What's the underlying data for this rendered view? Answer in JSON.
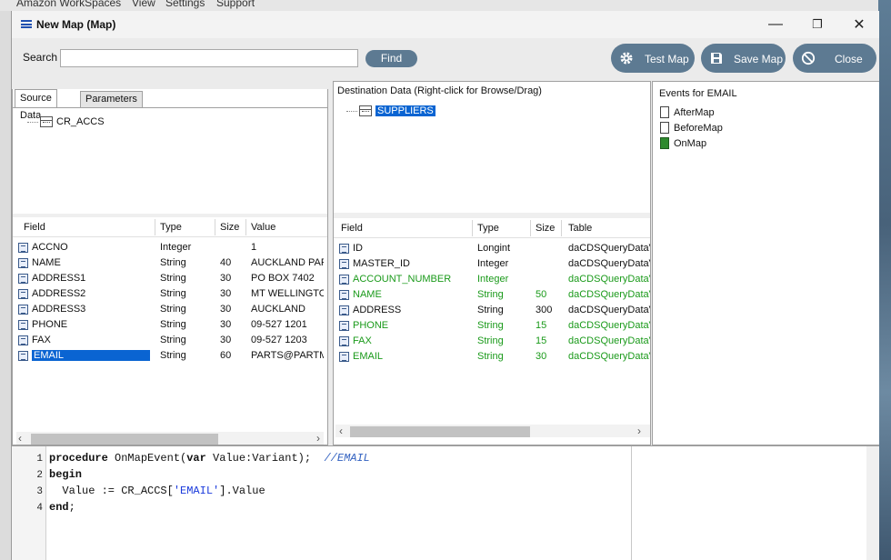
{
  "desktop": {
    "menu": [
      "Amazon WorkSpaces",
      "View",
      "Settings",
      "Support"
    ]
  },
  "window": {
    "title": "New Map (Map)",
    "controls": {
      "minimize": "—",
      "maximize": "❐",
      "close": "✕"
    }
  },
  "toolbar": {
    "search_label": "Search",
    "search_value": "",
    "find_label": "Find",
    "test_label": "Test Map",
    "save_label": "Save Map",
    "close_label": "Close"
  },
  "source": {
    "tabs": [
      "Source Data",
      "Parameters"
    ],
    "tree_item": "CR_ACCS",
    "columns": [
      "Field",
      "Type",
      "Size",
      "Value"
    ],
    "rows": [
      {
        "field": "ACCNO",
        "type": "Integer",
        "size": "",
        "value": "1"
      },
      {
        "field": "NAME",
        "type": "String",
        "size": "40",
        "value": "AUCKLAND PAR..."
      },
      {
        "field": "ADDRESS1",
        "type": "String",
        "size": "30",
        "value": "PO BOX 7402"
      },
      {
        "field": "ADDRESS2",
        "type": "String",
        "size": "30",
        "value": "MT WELLINGTON"
      },
      {
        "field": "ADDRESS3",
        "type": "String",
        "size": "30",
        "value": "AUCKLAND"
      },
      {
        "field": "PHONE",
        "type": "String",
        "size": "30",
        "value": "09-527 1201"
      },
      {
        "field": "FAX",
        "type": "String",
        "size": "30",
        "value": "09-527 1203"
      },
      {
        "field": "EMAIL",
        "type": "String",
        "size": "60",
        "value": "PARTS@PARTM..."
      }
    ]
  },
  "destination": {
    "header": "Destination Data   (Right-click for Browse/Drag)",
    "tree_item": "SUPPLIERS",
    "columns": [
      "Field",
      "Type",
      "Size",
      "Table"
    ],
    "rows": [
      {
        "field": "ID",
        "type": "Longint",
        "size": "",
        "table": "daCDSQueryDataV",
        "mapped": false
      },
      {
        "field": "MASTER_ID",
        "type": "Integer",
        "size": "",
        "table": "daCDSQueryDataV",
        "mapped": false
      },
      {
        "field": "ACCOUNT_NUMBER",
        "type": "Integer",
        "size": "",
        "table": "daCDSQueryDataV",
        "mapped": true
      },
      {
        "field": "NAME",
        "type": "String",
        "size": "50",
        "table": "daCDSQueryDataV",
        "mapped": true
      },
      {
        "field": "ADDRESS",
        "type": "String",
        "size": "300",
        "table": "daCDSQueryDataV",
        "mapped": false
      },
      {
        "field": "PHONE",
        "type": "String",
        "size": "15",
        "table": "daCDSQueryDataV",
        "mapped": true
      },
      {
        "field": "FAX",
        "type": "String",
        "size": "15",
        "table": "daCDSQueryDataV",
        "mapped": true
      },
      {
        "field": "EMAIL",
        "type": "String",
        "size": "30",
        "table": "daCDSQueryDataV",
        "mapped": true
      }
    ]
  },
  "events": {
    "header": "Events for EMAIL",
    "items": [
      "AfterMap",
      "BeforeMap",
      "OnMap"
    ]
  },
  "editor": {
    "line_numbers": [
      "1",
      "2",
      "3",
      "4"
    ]
  },
  "colors": {
    "accent": "#5d7a92",
    "mapped": "#1a9a1a",
    "selection": "#0a64d2"
  }
}
